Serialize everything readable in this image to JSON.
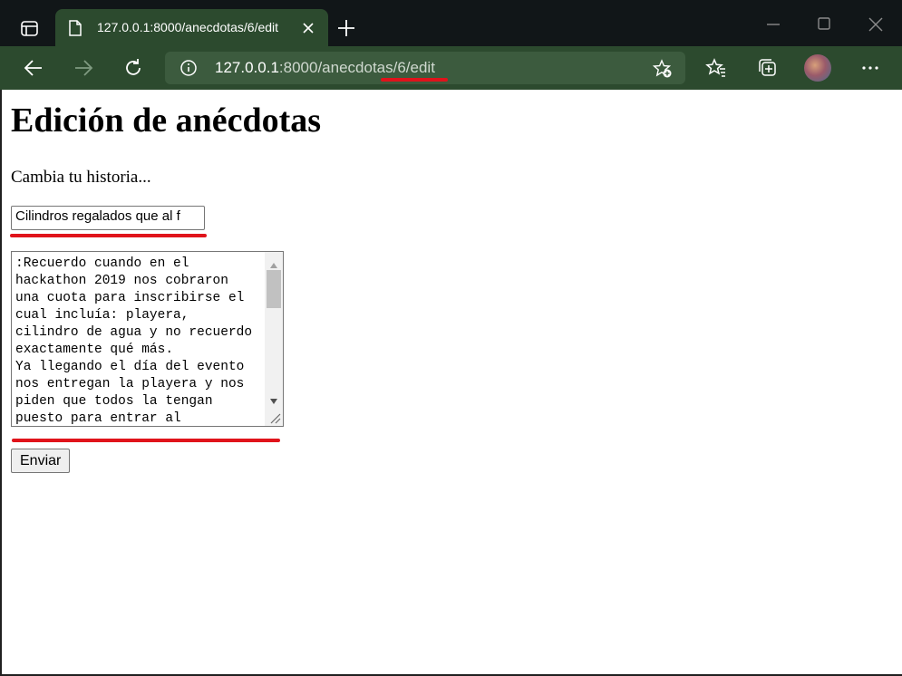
{
  "browser": {
    "tab_title": "127.0.0.1:8000/anecdotas/6/edit",
    "address_host": "127.0.0.1",
    "address_path": ":8000/anecdotas/6/edit",
    "accent_color": "#2c4a2e",
    "annotation_color": "#e0131b"
  },
  "page": {
    "title": "Edición de anécdotas",
    "subtitle": "Cambia tu historia...",
    "title_input_value": "Cilindros regalados que al f",
    "story_value": ":Recuerdo cuando en el\nhackathon 2019 nos cobraron\nuna cuota para inscribirse el\ncual incluía: playera,\ncilindro de agua y no recuerdo\nexactamente qué más.\nYa llegando el día del evento\nnos entregan la playera y nos\npiden que todos la tengan\npuesto para entrar al",
    "submit_label": "Enviar"
  }
}
